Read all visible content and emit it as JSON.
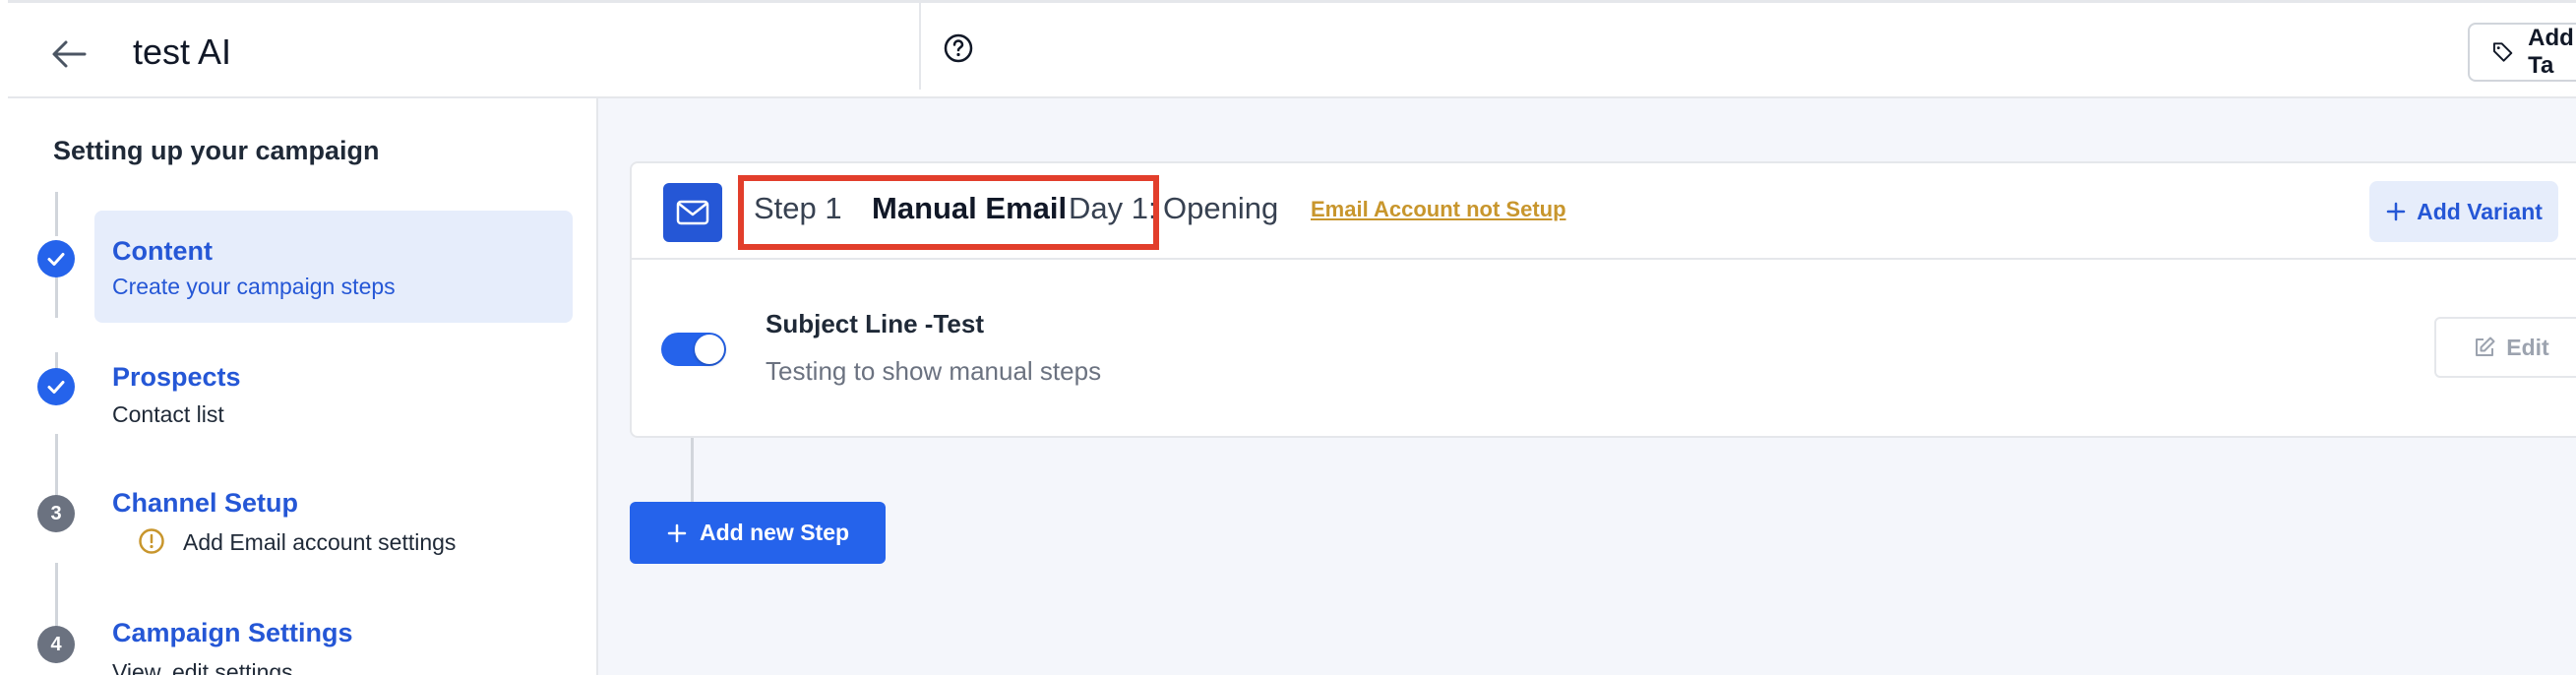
{
  "header": {
    "title": "test AI",
    "add_tag_label": "Add Ta"
  },
  "sidebar": {
    "title": "Setting up your campaign",
    "steps": [
      {
        "label": "Content",
        "sub": "Create your campaign steps",
        "status": "done",
        "active": true
      },
      {
        "label": "Prospects",
        "sub": "Contact list",
        "status": "done"
      },
      {
        "label": "Channel Setup",
        "number": "3",
        "sub": "Add Email account settings",
        "warning": true
      },
      {
        "label": "Campaign Settings",
        "number": "4",
        "sub": "View, edit settings"
      }
    ]
  },
  "step_card": {
    "step_no": "Step 1",
    "name": "Manual Email",
    "day": "Day 1:",
    "opening": "Opening",
    "account_warning": "Email Account not Setup",
    "add_variant_label": "Add Variant",
    "variant": {
      "subject": "Subject Line -Test",
      "description": "Testing to show manual steps",
      "enabled": true,
      "edit_label": "Edit"
    }
  },
  "add_step_label": "Add new Step",
  "colors": {
    "primary": "#2563eb",
    "link_warning": "#c8962d",
    "highlight": "#e23e2b"
  }
}
